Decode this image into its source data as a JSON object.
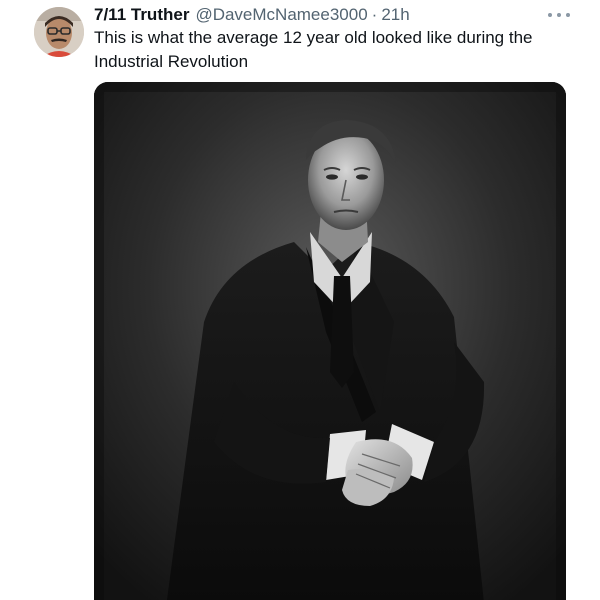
{
  "tweet": {
    "author": {
      "display_name": "7/11 Truther",
      "handle": "@DaveMcNamee3000",
      "separator": "·",
      "timestamp": "21h",
      "avatar_icon": "user-avatar"
    },
    "text": "This is what the average 12 year old looked like during the Industrial Revolution",
    "more_icon": "more-options-icon",
    "media": {
      "kind": "photo",
      "description_icon": "portrait-photo"
    }
  }
}
